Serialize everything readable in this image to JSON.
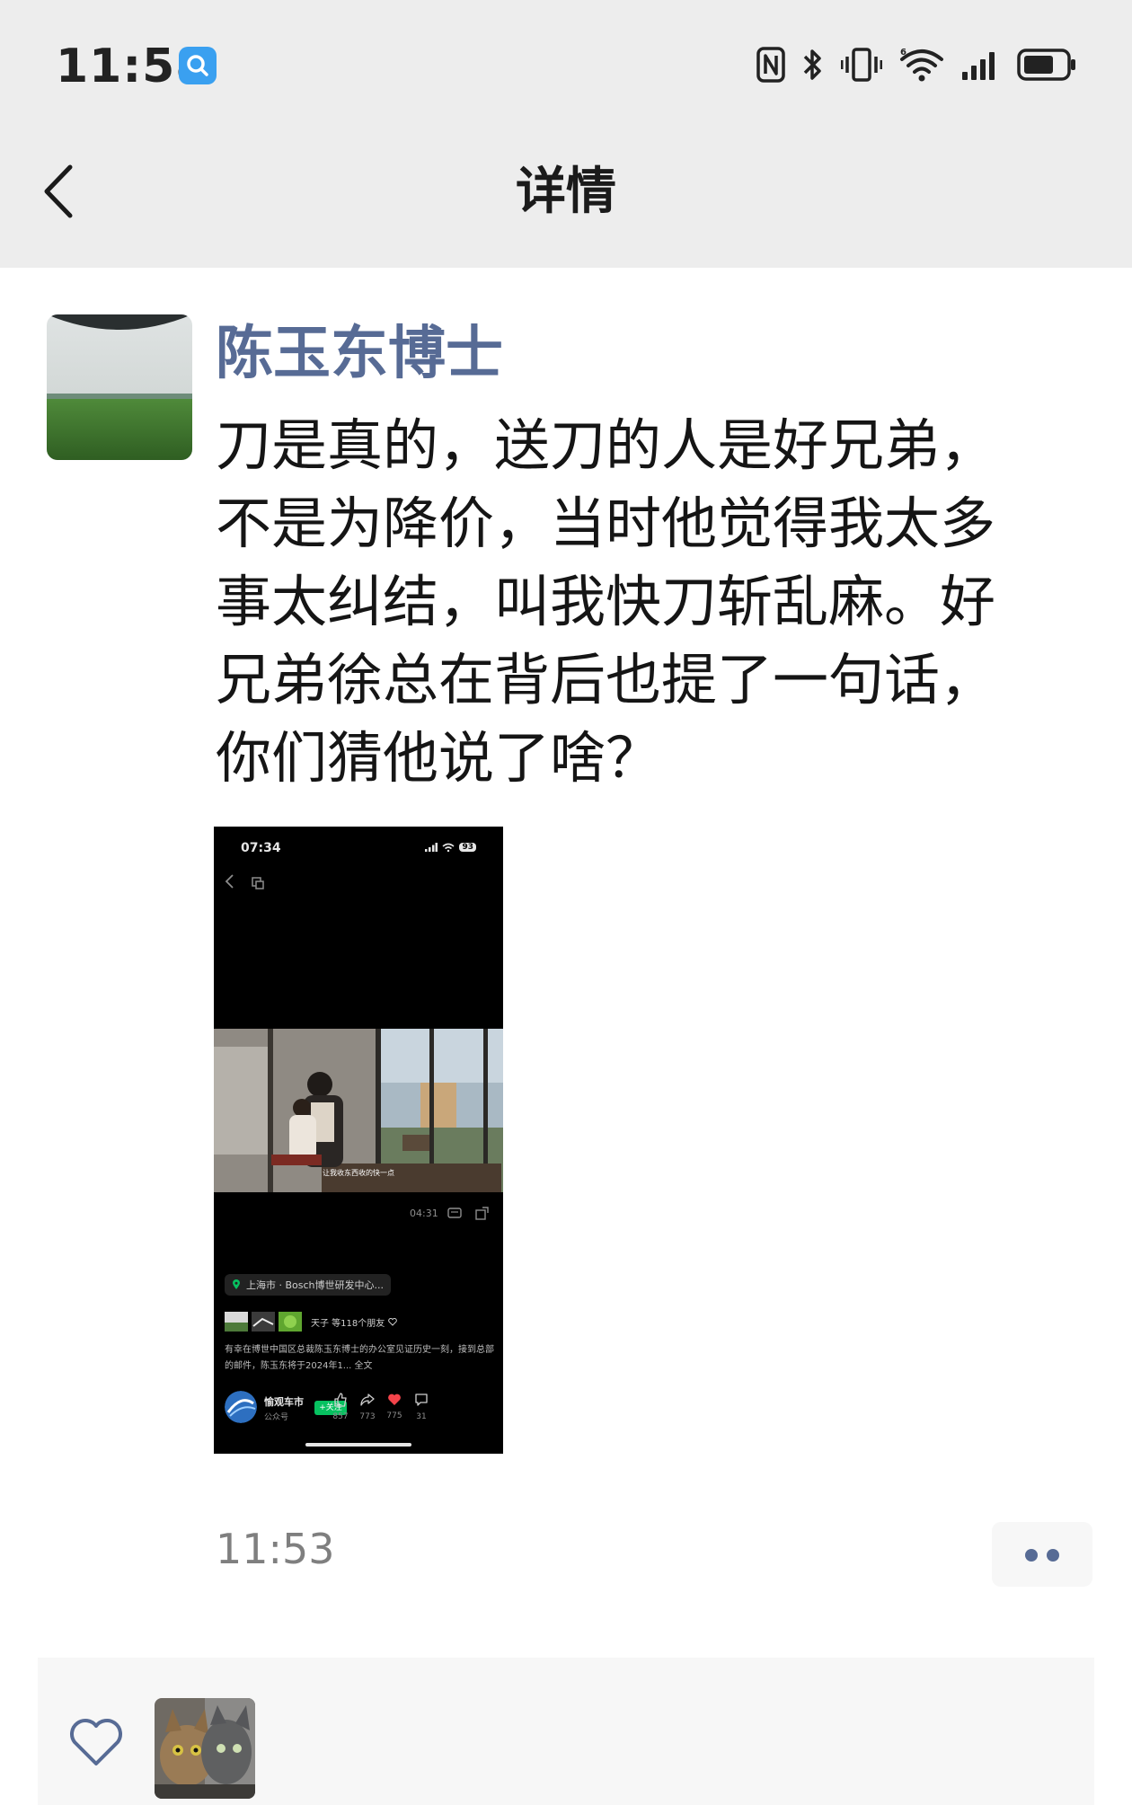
{
  "status_bar": {
    "time": "11:58",
    "icons": [
      "search-app-icon",
      "nfc-icon",
      "bluetooth-icon",
      "vibrate-icon",
      "wifi-icon",
      "signal-icon",
      "battery-icon"
    ]
  },
  "nav": {
    "title": "详情",
    "back_icon": "chevron-left-icon"
  },
  "post": {
    "author": "陈玉东博士",
    "text": "刀是真的，送刀的人是好兄弟，\n不是为降价，当时他觉得我太多\n事太纠结，叫我快刀斩乱麻。好\n兄弟徐总在背后也提了一句话，\n你们猜他说了啥？",
    "time": "11:53",
    "more_icon": "more-dots-icon"
  },
  "embedded_screenshot": {
    "time": "07:34",
    "battery": "93",
    "video_caption": "让我收东西收的快一点",
    "video_duration": "04:31",
    "location": "上海市 · Bosch博世研发中心...",
    "friends_text": "天子 等118个朋友",
    "description": "有幸在博世中国区总裁陈玉东博士的办公室见证历史一刻，接到总部的邮件，陈玉东将于2024年1... 全文",
    "publisher": "愉观车市",
    "publisher_type": "公众号",
    "follow_label": "+关注",
    "like_count": "857",
    "share_count": "773",
    "heart_count": "775",
    "comment_count": "31"
  },
  "likes": {
    "icon": "heart-outline-icon"
  },
  "colors": {
    "accent_name": "#576b95",
    "header_bg": "#ededed",
    "likes_bg": "#f7f7f7",
    "follow_green": "#07c160"
  }
}
